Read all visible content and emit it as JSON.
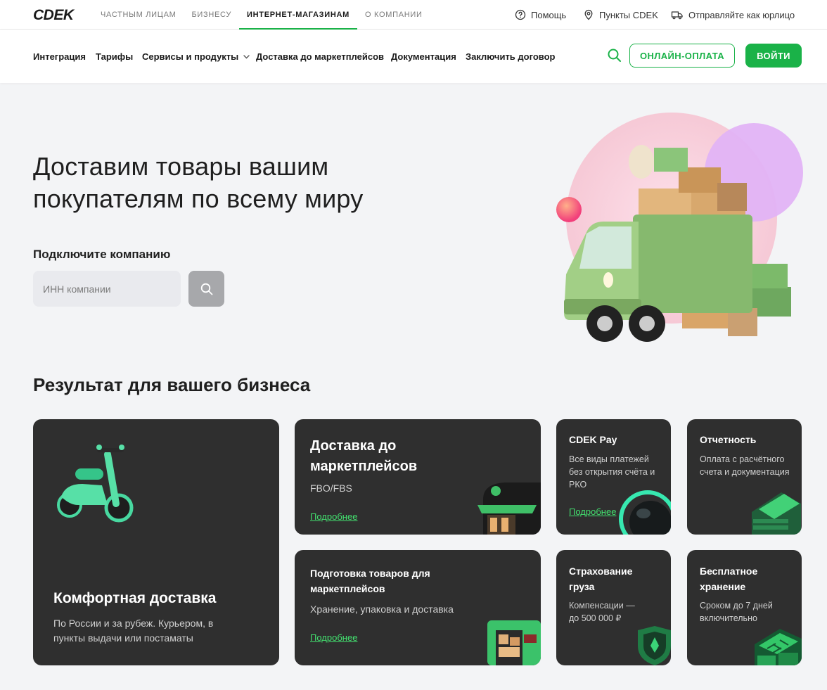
{
  "brand": {
    "name": "CDEK",
    "accent": "#1ab248",
    "card_bg": "#2f2f2f",
    "link": "#43e06f"
  },
  "segments": [
    {
      "label": "Частным лицам"
    },
    {
      "label": "Бизнесу"
    },
    {
      "label": "Интернет-магазинам"
    },
    {
      "label": "О компании"
    }
  ],
  "segment_active": "Интернет-магазинам",
  "utility": {
    "help": "Помощь",
    "points": "Пункты CDEK",
    "legal": "Отправляйте как юрлицо"
  },
  "nav": {
    "items": [
      "Интеграция",
      "Тарифы",
      "Сервисы и продукты",
      "Доставка до маркетплейсов",
      "Документация",
      "Заключить договор"
    ],
    "online_payment": "ОНЛАЙН-ОПЛАТА",
    "login": "ВОЙТИ"
  },
  "hero": {
    "title": "Доставим товары вашим покупателям по всему миру",
    "connect_label": "Подключите компанию",
    "inn_placeholder": "ИНН компании"
  },
  "results": {
    "title": "Результат для вашего бизнеса",
    "cards": [
      {
        "title": "Комфортная доставка",
        "text": "По России и за рубеж. Курьером, в пункты выдачи или постаматы"
      },
      {
        "title": "Доставка до маркетплейсов",
        "text": "FBO/FBS",
        "link": "Подробнее"
      },
      {
        "title": "CDEK Pay",
        "text": "Все виды платежей без открытия счёта и РКО",
        "link": "Подробнее"
      },
      {
        "title": "Отчетность",
        "text": "Оплата с расчётного счета и документация"
      },
      {
        "title": "Подготовка товаров для маркетплейсов",
        "text": "Хранение, упаковка и доставка",
        "link": "Подробнее"
      },
      {
        "title": "Страхование груза",
        "text": "Компенсации — до 500 000 ₽"
      },
      {
        "title": "Бесплатное хранение",
        "text": "Сроком до 7 дней включительно"
      }
    ]
  }
}
